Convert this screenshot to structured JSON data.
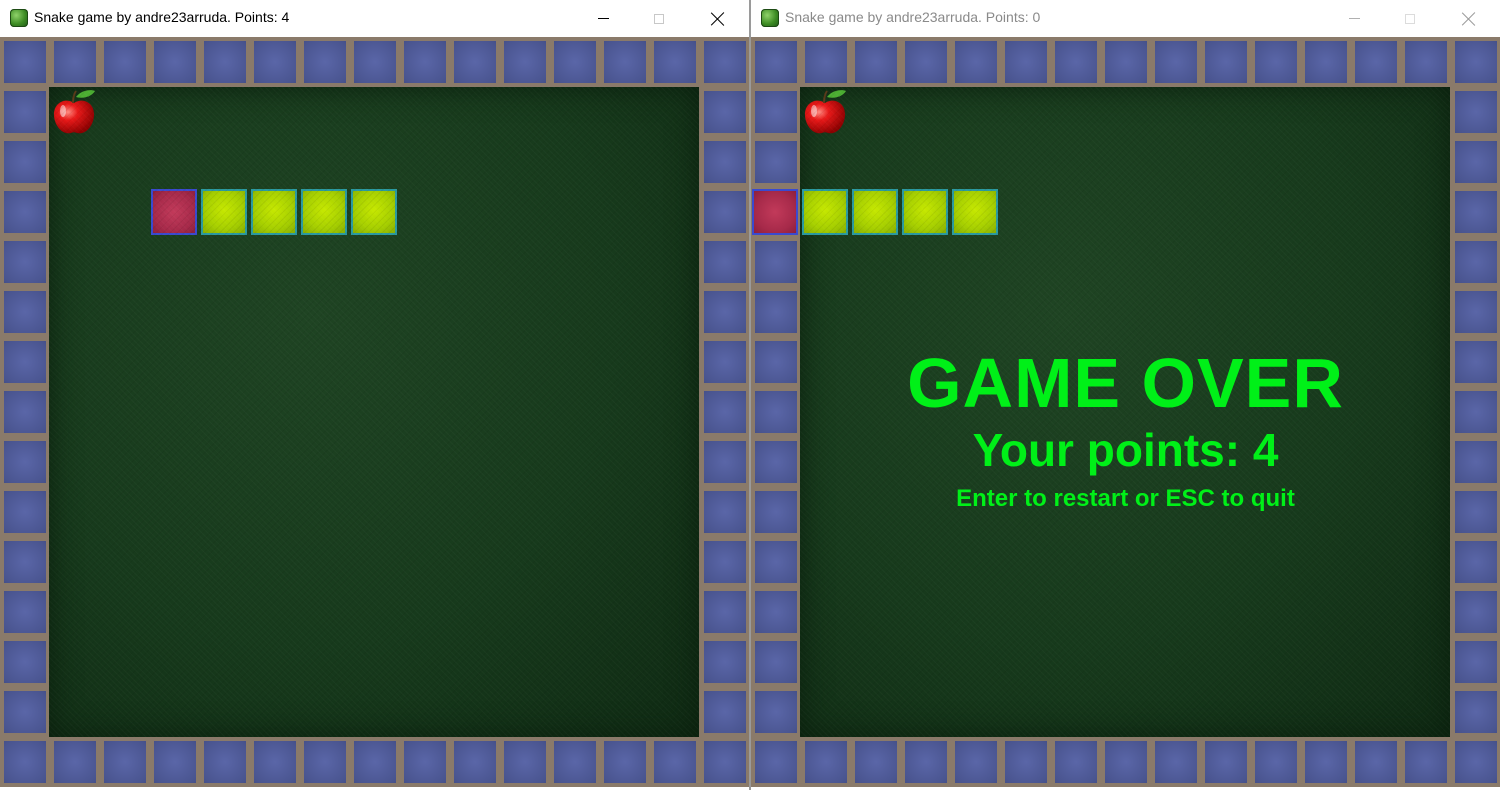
{
  "windows": [
    {
      "title": "Snake game by andre23arruda. Points: 4",
      "state": "playing",
      "active": true,
      "apple": {
        "col": 0,
        "row": 0,
        "icon": "apple-icon"
      },
      "snake": {
        "head": {
          "col": 2,
          "row": 2
        },
        "body": [
          {
            "col": 3,
            "row": 2
          },
          {
            "col": 4,
            "row": 2
          },
          {
            "col": 5,
            "row": 2
          },
          {
            "col": 6,
            "row": 2
          }
        ]
      }
    },
    {
      "title": "Snake game by andre23arruda. Points: 0",
      "state": "game-over",
      "active": false,
      "apple": {
        "col": 0,
        "row": 0,
        "icon": "apple-icon"
      },
      "snake": {
        "head": {
          "col": -1,
          "row": 2
        },
        "body": [
          {
            "col": 0,
            "row": 2
          },
          {
            "col": 1,
            "row": 2
          },
          {
            "col": 2,
            "row": 2
          },
          {
            "col": 3,
            "row": 2
          }
        ]
      },
      "game_over": {
        "title": "GAME OVER",
        "points_text": "Your points: 4",
        "hint": "Enter to restart or ESC to quit"
      }
    }
  ],
  "colors": {
    "overlay_text": "#00f018",
    "border_tile": "#4e5a95",
    "field": "#173a1c",
    "snake_body": "#a6cf00",
    "snake_head": "#a72a4a"
  }
}
